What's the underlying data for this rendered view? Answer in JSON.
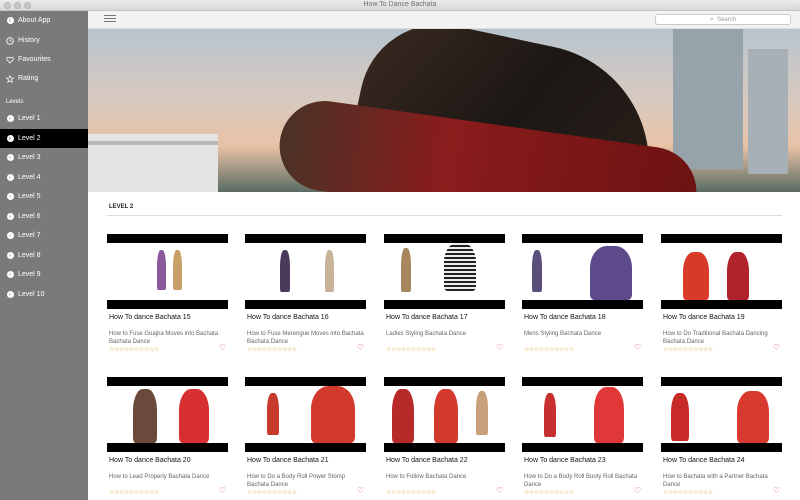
{
  "window": {
    "title": "How To Dance Bachata"
  },
  "sidebar": {
    "top_items": [
      {
        "label": "About App",
        "icon": "info-icon"
      },
      {
        "label": "History",
        "icon": "clock-icon"
      },
      {
        "label": "Favourites",
        "icon": "heart-icon"
      },
      {
        "label": "Rating",
        "icon": "star-icon"
      }
    ],
    "levels_heading": "Levels",
    "levels": [
      {
        "label": "Level 1",
        "active": false
      },
      {
        "label": "Level 2",
        "active": true
      },
      {
        "label": "Level 3",
        "active": false
      },
      {
        "label": "Level 4",
        "active": false
      },
      {
        "label": "Level 5",
        "active": false
      },
      {
        "label": "Level 6",
        "active": false
      },
      {
        "label": "Level 7",
        "active": false
      },
      {
        "label": "Level 8",
        "active": false
      },
      {
        "label": "Level 9",
        "active": false
      },
      {
        "label": "Level 10",
        "active": false
      }
    ]
  },
  "toolbar": {
    "search_placeholder": "Search"
  },
  "main": {
    "section_label": "LEVEL 2",
    "videos": [
      {
        "title": "How To dance Bachata 15",
        "desc": "How to Fuse Guajira Moves into Bachata Bachata Dance"
      },
      {
        "title": "How To dance Bachata 16",
        "desc": "How to Fuse Merengue Moves into Bachata Bachata Dance"
      },
      {
        "title": "How To dance Bachata 17",
        "desc": "Ladies Styling  Bachata Dance"
      },
      {
        "title": "How To dance Bachata 18",
        "desc": "Mens Styling  Bachata Dance"
      },
      {
        "title": "How To dance Bachata 19",
        "desc": "How to Do Traditional Bachata Dancing Bachata Dance"
      },
      {
        "title": "How To dance Bachata 20",
        "desc": "How to Lead Properly  Bachata Dance"
      },
      {
        "title": "How To dance Bachata 21",
        "desc": "How to Do a Body Roll  Power Stomp  Bachata Dance"
      },
      {
        "title": "How To dance Bachata 22",
        "desc": "How to Follow  Bachata Dance"
      },
      {
        "title": "How To dance Bachata 23",
        "desc": "How to Do a Body Roll  Booty Roll  Bachata Dance"
      },
      {
        "title": "How To dance Bachata 24",
        "desc": "How to Bachata with a Partner  Bachata Dance"
      }
    ],
    "rating_stars": "☆☆☆☆☆☆☆☆☆☆",
    "heart_glyph": "♡"
  },
  "colors": {
    "sidebar_bg": "#7a7a7a",
    "active_item": "#000000",
    "star": "#d9a12a",
    "heart": "#e0405a"
  }
}
